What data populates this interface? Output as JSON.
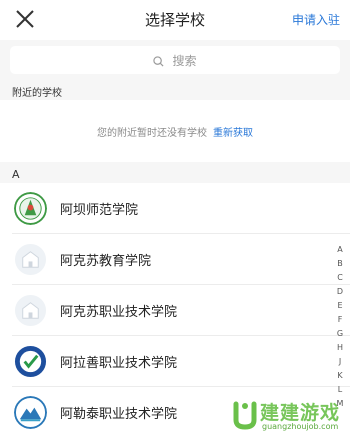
{
  "header": {
    "title": "选择学校",
    "apply_label": "申请入驻"
  },
  "search": {
    "placeholder": "搜索"
  },
  "nearby": {
    "section_title": "附近的学校",
    "empty_text": "您的附近暂时还没有学校",
    "refresh_label": "重新获取"
  },
  "list": {
    "section_letter": "A",
    "schools": [
      {
        "name": "阿坝师范学院",
        "logo_icon": "green-seal-logo-icon"
      },
      {
        "name": "阿克苏教育学院",
        "logo_icon": "placeholder-school-icon"
      },
      {
        "name": "阿克苏职业技术学院",
        "logo_icon": "placeholder-school-icon"
      },
      {
        "name": "阿拉善职业技术学院",
        "logo_icon": "blue-check-logo-icon"
      },
      {
        "name": "阿勒泰职业技术学院",
        "logo_icon": "mountain-logo-icon"
      }
    ]
  },
  "index_letters": [
    "A",
    "B",
    "C",
    "D",
    "E",
    "F",
    "G",
    "H",
    "J",
    "K",
    "L",
    "M"
  ],
  "watermark": {
    "text": "建建游戏",
    "url": "guangzhoujob.com"
  },
  "colors": {
    "accent": "#2a78d8",
    "background": "#f6f6f6",
    "watermark": "#6ac04a"
  }
}
